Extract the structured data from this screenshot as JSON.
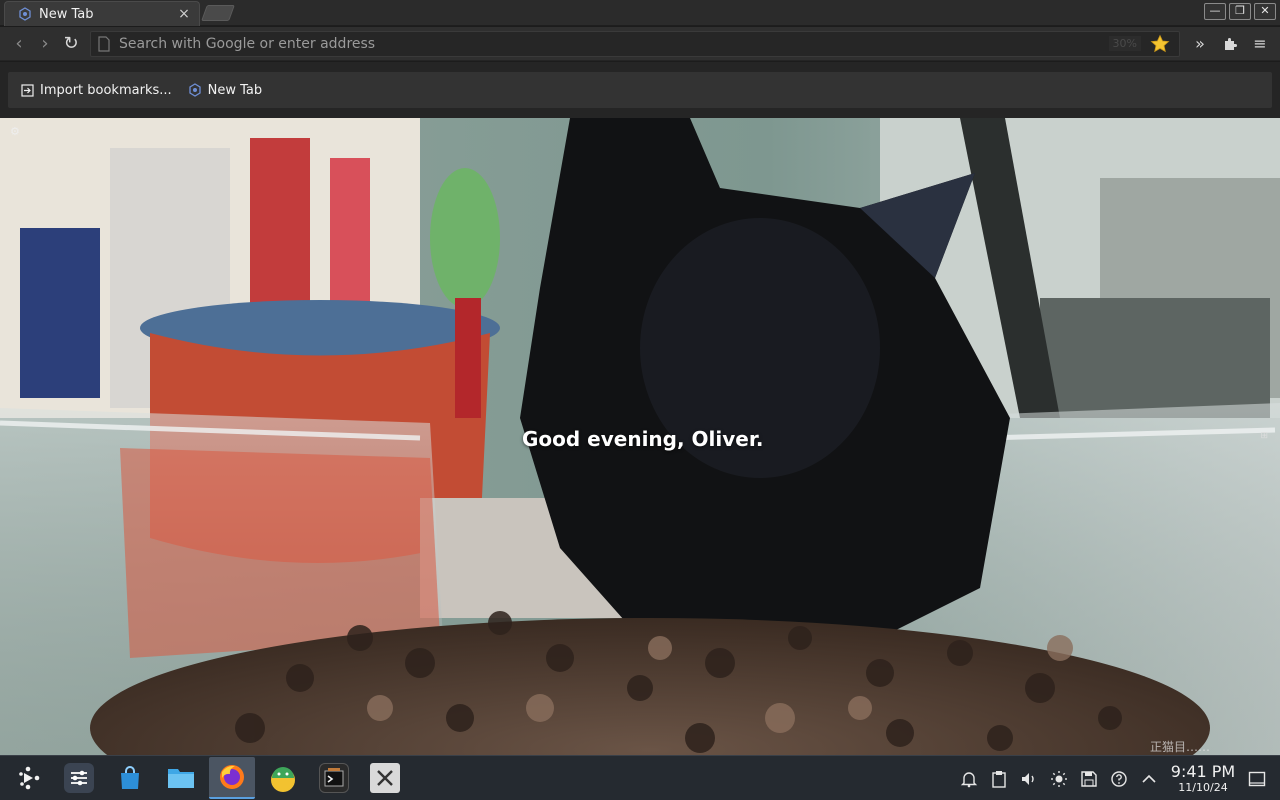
{
  "browser": {
    "tab": {
      "title": "New Tab",
      "close_glyph": "×"
    },
    "window_controls": {
      "minimize": "—",
      "restore": "❐",
      "close": "✕"
    },
    "nav": {
      "back_glyph": "‹",
      "forward_glyph": "›",
      "reload_glyph": "↻",
      "url_placeholder": "Search with Google or enter address",
      "url_value": "",
      "zoom": "30%",
      "overflow_glyph": "»",
      "menu_glyph": "≡"
    },
    "bookmarks": [
      {
        "label": "Import bookmarks...",
        "icon": "import-icon"
      },
      {
        "label": "New Tab",
        "icon": "browser-logo-icon"
      }
    ]
  },
  "newtab": {
    "greeting": "Good evening, Oliver.",
    "settings_glyph": "⚙",
    "edge_glyph": "⊞",
    "corner_text": "正猫目……"
  },
  "taskbar": {
    "apps": [
      {
        "name": "app-launcher",
        "icon": "launcher-icon"
      },
      {
        "name": "system-settings",
        "icon": "settings-sliders-icon"
      },
      {
        "name": "discover-store",
        "icon": "store-bag-icon"
      },
      {
        "name": "file-manager",
        "icon": "folder-icon"
      },
      {
        "name": "firefox",
        "icon": "firefox-icon",
        "active": true
      },
      {
        "name": "app-greenhead",
        "icon": "android-studio-icon"
      },
      {
        "name": "terminal",
        "icon": "terminal-icon"
      },
      {
        "name": "xorg-app",
        "icon": "x-app-icon"
      }
    ],
    "tray": {
      "clock_time": "9:41 PM",
      "clock_date": "11/10/24"
    }
  },
  "colors": {
    "accent": "#5aa0e0",
    "tab_bg": "#3a3a3a",
    "taskbar_bg": "#252a30"
  }
}
